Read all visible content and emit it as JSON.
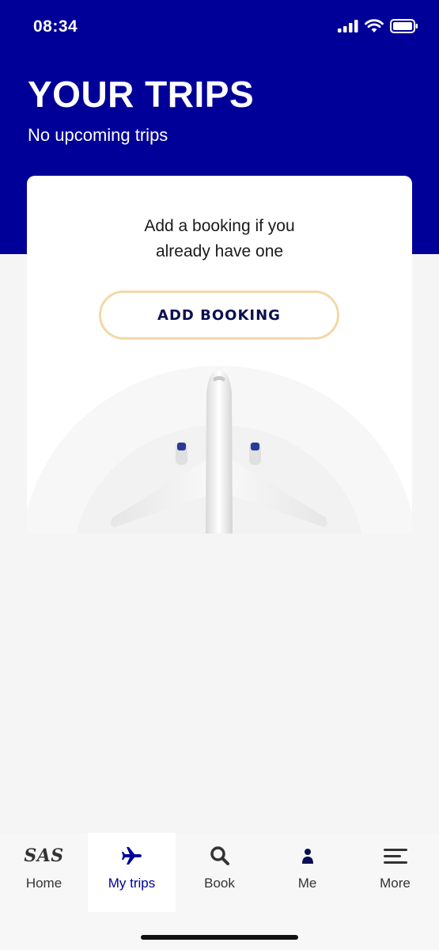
{
  "status_bar": {
    "time": "08:34"
  },
  "header": {
    "title": "YOUR TRIPS",
    "subtitle": "No upcoming trips"
  },
  "card": {
    "message_line1": "Add a booking if you",
    "message_line2": "already have one",
    "button_label": "ADD BOOKING"
  },
  "tabs": [
    {
      "label": "Home",
      "icon": "sas-logo-icon",
      "logo_text": "SAS"
    },
    {
      "label": "My trips",
      "icon": "airplane-icon",
      "active": true
    },
    {
      "label": "Book",
      "icon": "search-icon"
    },
    {
      "label": "Me",
      "icon": "person-icon"
    },
    {
      "label": "More",
      "icon": "menu-icon"
    }
  ],
  "colors": {
    "brand_blue": "#000099",
    "button_border": "#f3d8a6",
    "button_text": "#0a1050",
    "background": "#f5f5f5"
  }
}
